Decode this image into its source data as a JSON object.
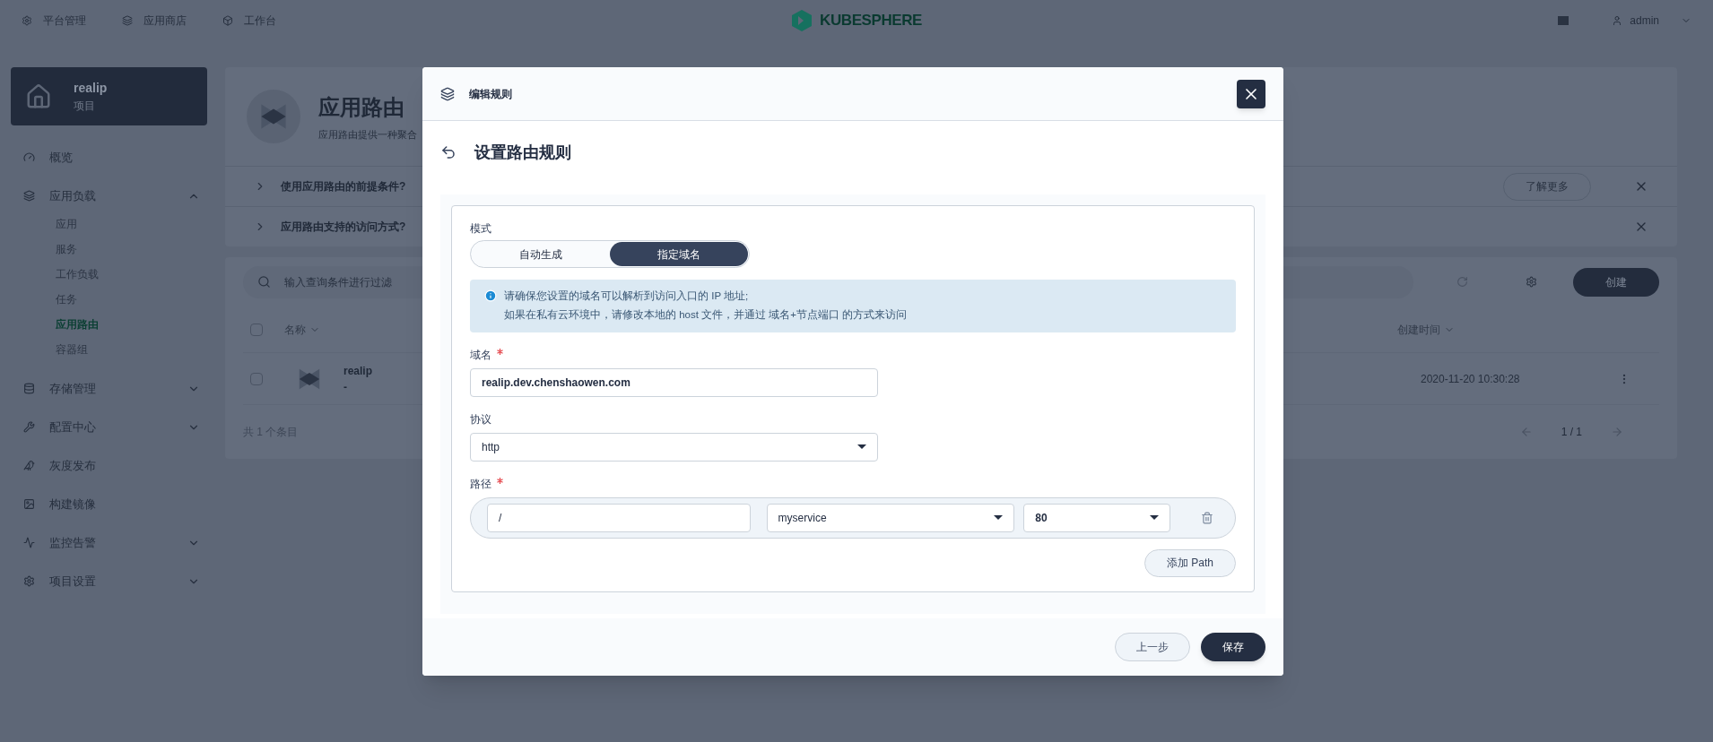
{
  "top_nav": {
    "items": [
      {
        "label": "平台管理"
      },
      {
        "label": "应用商店"
      },
      {
        "label": "工作台"
      }
    ],
    "logo": "KUBESPHERE",
    "user": "admin"
  },
  "project": {
    "name": "realip",
    "type": "项目"
  },
  "sidebar": {
    "items": [
      {
        "label": "概览"
      },
      {
        "label": "应用负载",
        "expanded": true,
        "children": [
          {
            "label": "应用",
            "selected": false
          },
          {
            "label": "服务",
            "selected": false
          },
          {
            "label": "工作负载",
            "selected": false
          },
          {
            "label": "任务",
            "selected": false
          },
          {
            "label": "应用路由",
            "selected": true
          },
          {
            "label": "容器组",
            "selected": false
          }
        ]
      },
      {
        "label": "存储管理",
        "expanded": false
      },
      {
        "label": "配置中心",
        "expanded": false
      },
      {
        "label": "灰度发布"
      },
      {
        "label": "构建镜像"
      },
      {
        "label": "监控告警",
        "expanded": false
      },
      {
        "label": "项目设置",
        "expanded": false
      }
    ]
  },
  "page_header": {
    "title": "应用路由",
    "description": "应用路由提供一种聚合"
  },
  "help": [
    {
      "question": "使用应用路由的前提条件?",
      "button": "了解更多"
    },
    {
      "question": "应用路由支持的访问方式?"
    }
  ],
  "toolbar": {
    "search": {
      "placeholder": "输入查询条件进行过滤"
    },
    "create": "创建"
  },
  "table": {
    "columns": [
      "名称",
      "创建时间"
    ],
    "all_checked": false,
    "rows": [
      {
        "name": "realip",
        "description": "-",
        "created": "2020-11-20 10:30:28",
        "checked": false
      }
    ],
    "total": "共 1 个条目",
    "pages": "1 / 1"
  },
  "modal": {
    "title": "编辑规则",
    "step_title": "设置路由规则",
    "mode": {
      "label": "模式",
      "options": [
        {
          "label": "自动生成",
          "selected": false
        },
        {
          "label": "指定域名",
          "selected": true
        }
      ]
    },
    "info": [
      "请确保您设置的域名可以解析到访问入口的 IP 地址;",
      "如果在私有云环境中，请修改本地的 host 文件，并通过 域名+节点端口 的方式来访问"
    ],
    "domain": {
      "label": "域名",
      "required": true,
      "value": "realip.dev.chenshaowen.com"
    },
    "protocol": {
      "label": "协议",
      "value": "http"
    },
    "paths": {
      "label": "路径",
      "required": true,
      "rows": [
        {
          "path": "/",
          "service": "myservice",
          "port": "80"
        }
      ],
      "add": "添加 Path"
    },
    "buttons": {
      "back": "上一步",
      "save": "保存"
    }
  }
}
